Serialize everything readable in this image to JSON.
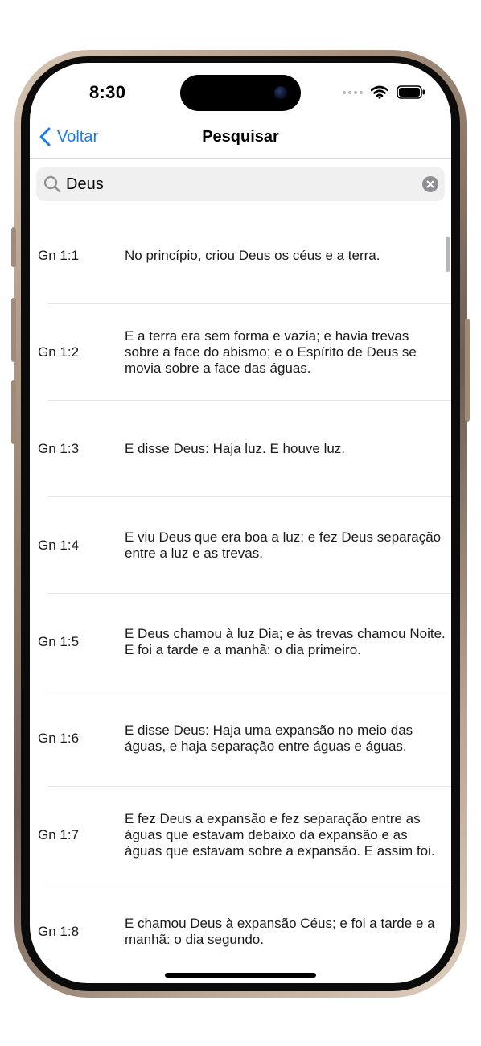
{
  "status": {
    "time": "8:30"
  },
  "nav": {
    "back_label": "Voltar",
    "title": "Pesquisar"
  },
  "search": {
    "value": "Deus"
  },
  "results": [
    {
      "ref": "Gn 1:1",
      "text": "No princípio, criou Deus os céus e a terra."
    },
    {
      "ref": "Gn 1:2",
      "text": "E a terra era sem forma e vazia; e havia trevas sobre a face do abismo; e o Espírito de Deus se movia sobre a face das águas."
    },
    {
      "ref": "Gn 1:3",
      "text": "E disse Deus: Haja luz. E houve luz."
    },
    {
      "ref": "Gn 1:4",
      "text": "E viu Deus que era boa a luz; e fez Deus separação entre a luz e as trevas."
    },
    {
      "ref": "Gn 1:5",
      "text": "E Deus chamou à luz Dia; e às trevas chamou Noite. E foi a tarde e a manhã: o dia primeiro."
    },
    {
      "ref": "Gn 1:6",
      "text": "E disse Deus: Haja uma expansão no meio das águas, e haja separação entre águas e águas."
    },
    {
      "ref": "Gn 1:7",
      "text": "E fez Deus a expansão e fez separação entre as águas que estavam debaixo da expansão e as águas que estavam sobre a expansão. E assim foi."
    },
    {
      "ref": "Gn 1:8",
      "text": "E chamou Deus à expansão Céus; e foi a tarde e a manhã: o dia segundo."
    }
  ],
  "colors": {
    "accent": "#1a7bf2",
    "separator": "#e4e4e6",
    "search_bg": "#f0f0f1"
  },
  "icons": {
    "back": "chevron-left-icon",
    "search": "magnifier-icon",
    "clear": "clear-x-icon",
    "wifi": "wifi-icon",
    "battery": "battery-icon"
  }
}
